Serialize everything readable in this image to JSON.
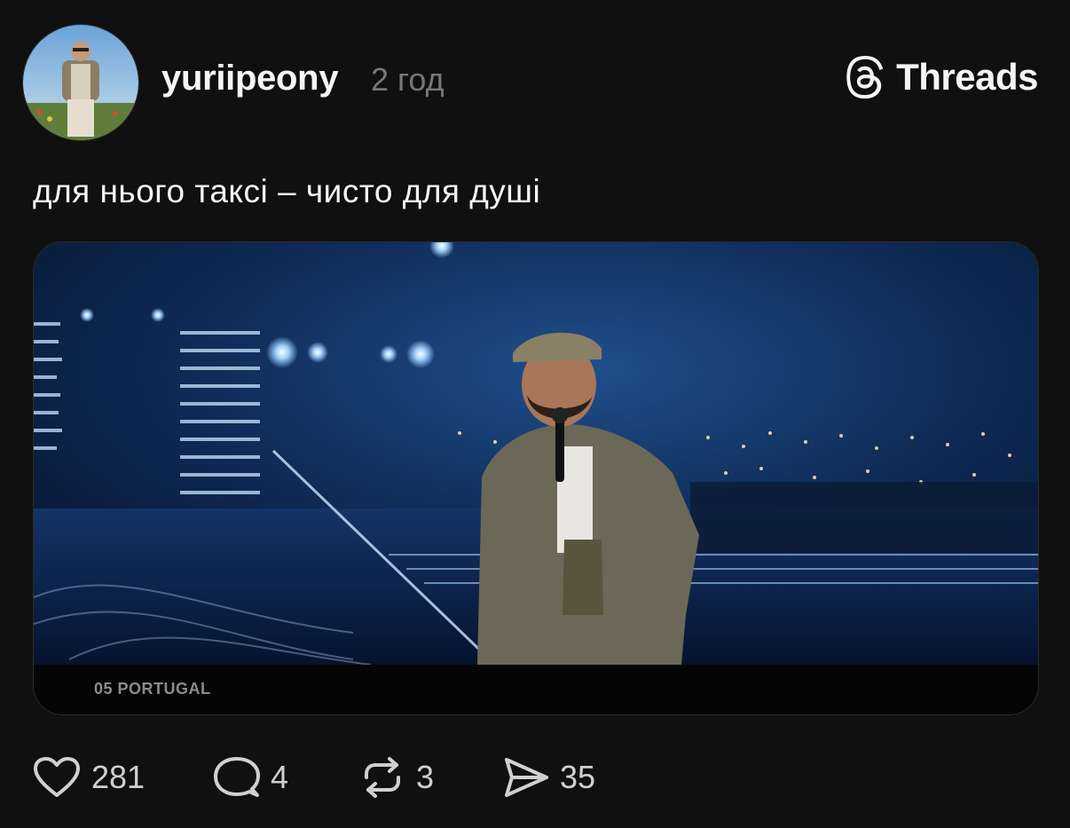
{
  "post": {
    "username": "yuriipeony",
    "time": "2 год",
    "text": "для нього таксі – чисто для душі"
  },
  "brand": {
    "name": "Threads"
  },
  "media": {
    "caption": "05 PORTUGAL"
  },
  "actions": {
    "likes": "281",
    "comments": "4",
    "reposts": "3",
    "shares": "35"
  },
  "icons": {
    "like": "heart-icon",
    "comment": "comment-bubble-icon",
    "repost": "repost-icon",
    "share": "send-icon",
    "brand": "threads-logo-icon"
  },
  "colors": {
    "background": "#101010",
    "text": "#f3f5f7",
    "muted": "#777777"
  }
}
